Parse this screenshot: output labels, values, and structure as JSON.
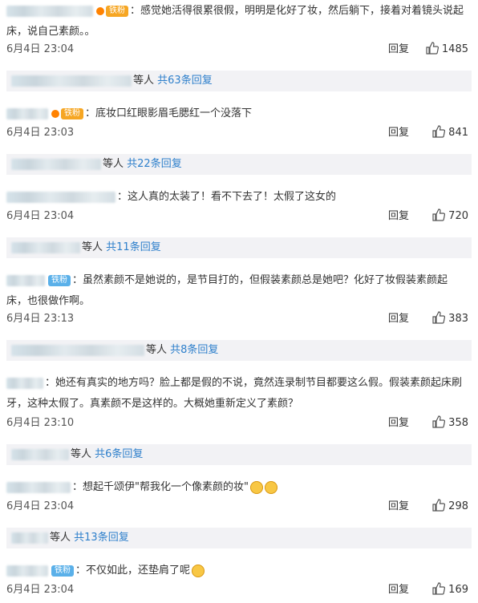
{
  "comments": [
    {
      "text": "：感觉她活得很累很假，明明是化好了妆，然后躺下，接着对着镜头说起",
      "text2": "床，说自己素颜。。",
      "badge": "铁粉",
      "date": "6月4日 23:04",
      "reply": "回复",
      "likes": "1485",
      "sub_text": "等人",
      "sub_link": "共63条回复"
    },
    {
      "text": "：底妆口红眼影眉毛腮红一个没落下",
      "badge": "铁粉",
      "date": "6月4日 23:03",
      "reply": "回复",
      "likes": "841",
      "sub_text": "等人",
      "sub_link": "共22条回复"
    },
    {
      "text": "：这人真的太装了！看不下去了！太假了这女的",
      "date": "6月4日 23:04",
      "reply": "回复",
      "likes": "720",
      "sub_text": "等人",
      "sub_link": "共11条回复"
    },
    {
      "text": "：虽然素颜不是她说的，是节目打的，但假装素颜总是她吧？化好了妆假装素颜起",
      "text2": "床，也很做作啊。",
      "badge": "铁粉",
      "date": "6月4日 23:13",
      "reply": "回复",
      "likes": "383",
      "sub_text": "等人",
      "sub_link": "共8条回复"
    },
    {
      "text": "：她还有真实的地方吗？脸上都是假的不说，竟然连录制节目都要这么假。假装素颜起床刷",
      "text2": "牙，这种太假了。真素颜不是这样的。大概她重新定义了素颜？",
      "date": "6月4日 23:10",
      "reply": "回复",
      "likes": "358",
      "sub_text": "等人",
      "sub_link": "共6条回复"
    },
    {
      "text": "：想起千颂伊\"帮我化一个像素颜的妆\"",
      "date": "6月4日 23:04",
      "reply": "回复",
      "likes": "298",
      "sub_text": "等人",
      "sub_link": "共13条回复"
    },
    {
      "text": "：不仅如此，还垫肩了呢",
      "badge": "铁粉",
      "date": "6月4日 23:04",
      "reply": "回复",
      "likes": "169"
    }
  ]
}
